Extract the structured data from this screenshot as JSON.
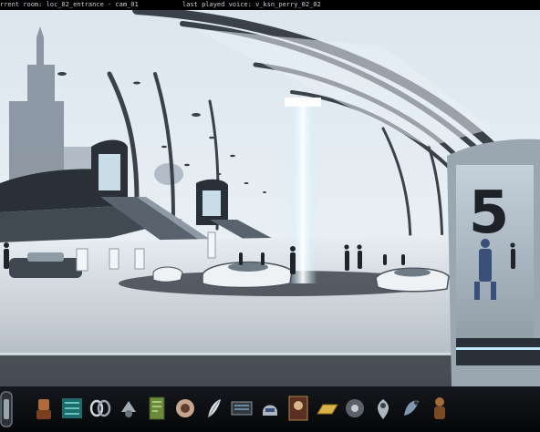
{
  "debug": {
    "room_text": "rrent room: loc_02_entrance - cam_01",
    "voice_text": "last played voice: v_ksn_perry_02_02"
  },
  "scene": {
    "platform_number": "5"
  },
  "colors": {
    "sky": "#dfe9f1",
    "structure": "#2a3038",
    "floor": "#c9d2da",
    "glow": "#bfe9ff",
    "inventory_bg": "#0c0e12"
  },
  "inventory": {
    "items": [
      "robot-figure-icon",
      "circuit-board-icon",
      "chain-link-icon",
      "metal-clip-icon",
      "green-card-icon",
      "brain-device-icon",
      "feather-icon",
      "data-chip-icon",
      "helmet-icon",
      "portrait-card-icon",
      "gold-bar-icon",
      "round-gadget-icon",
      "location-pin-icon",
      "bird-statue-icon",
      "bronze-figure-icon"
    ]
  }
}
